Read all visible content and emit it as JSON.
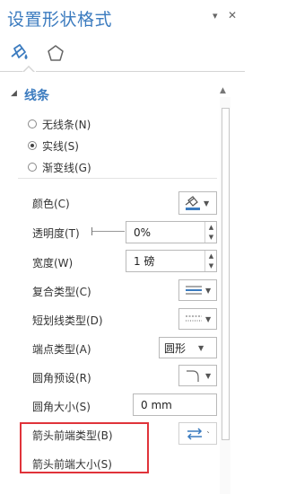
{
  "panel": {
    "title": "设置形状格式",
    "header_dropdown": "▾",
    "header_close": "✕"
  },
  "tabs": [
    {
      "icon": "fill-line-icon",
      "selected": true
    },
    {
      "icon": "pentagon-shape-icon",
      "selected": false
    }
  ],
  "section": {
    "toggle": "◢",
    "title": "线条"
  },
  "line_type_options": [
    {
      "label": "无线条(N)",
      "selected": false
    },
    {
      "label": "实线(S)",
      "selected": true
    },
    {
      "label": "渐变线(G)",
      "selected": false
    }
  ],
  "properties": {
    "color": {
      "label": "颜色(C)"
    },
    "transparency": {
      "label": "透明度(T)",
      "value": "0%"
    },
    "width": {
      "label": "宽度(W)",
      "value": "1 磅"
    },
    "compound_type": {
      "label": "复合类型(C)"
    },
    "dash_type": {
      "label": "短划线类型(D)"
    },
    "cap_type": {
      "label": "端点类型(A)",
      "value": "圆形"
    },
    "join_preset": {
      "label": "圆角预设(R)"
    },
    "join_size": {
      "label": "圆角大小(S)",
      "value": "0 mm"
    },
    "arrow_begin_type": {
      "label": "箭头前端类型(B)"
    },
    "arrow_begin_size": {
      "label": "箭头前端大小(S)"
    }
  },
  "colors": {
    "accent": "#3b7bbf",
    "highlight_box": "#e0333a"
  }
}
